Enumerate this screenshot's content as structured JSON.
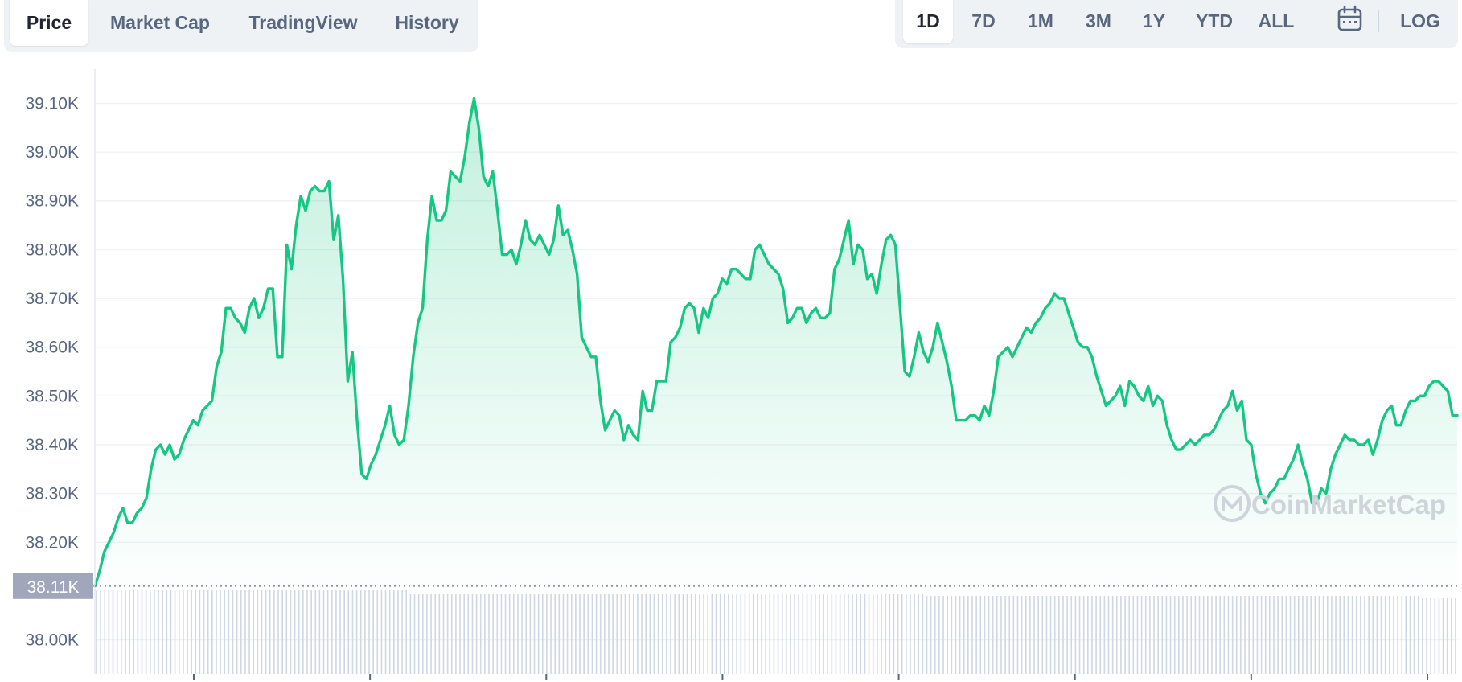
{
  "tabs": [
    {
      "label": "Price",
      "active": true
    },
    {
      "label": "Market Cap",
      "active": false
    },
    {
      "label": "TradingView",
      "active": false
    },
    {
      "label": "History",
      "active": false
    }
  ],
  "ranges": [
    {
      "label": "1D",
      "active": true
    },
    {
      "label": "7D",
      "active": false
    },
    {
      "label": "1M",
      "active": false
    },
    {
      "label": "3M",
      "active": false
    },
    {
      "label": "1Y",
      "active": false
    },
    {
      "label": "YTD",
      "active": false
    },
    {
      "label": "ALL",
      "active": false
    }
  ],
  "calendar_icon": "calendar-icon",
  "log_label": "LOG",
  "watermark": "CoinMarketCap",
  "colors": {
    "line": "#16c784",
    "fill_top": "#16c784",
    "grid": "#eff2f5",
    "text": "#58667e",
    "badge": "#a1a7bb",
    "volume": "#cfd6e4",
    "tab_bg": "#eff2f5"
  },
  "chart_data": {
    "type": "area",
    "title": "",
    "xlabel": "",
    "ylabel": "",
    "ylim": [
      37.93,
      39.17
    ],
    "y_ticks": [
      38.0,
      38.2,
      38.3,
      38.4,
      38.5,
      38.6,
      38.7,
      38.8,
      38.9,
      39.0,
      39.1
    ],
    "y_tick_labels": [
      "38.00K",
      "38.20K",
      "38.30K",
      "38.40K",
      "38.50K",
      "38.60K",
      "38.70K",
      "38.80K",
      "38.90K",
      "39.00K",
      "39.10K"
    ],
    "baseline": {
      "value": 38.11,
      "label": "38.11K"
    },
    "x_tick_count": 8,
    "grid": true,
    "legend": "none",
    "series": [
      {
        "values": [
          38.11,
          38.14,
          38.18,
          38.2,
          38.22,
          38.25,
          38.27,
          38.24,
          38.24,
          38.26,
          38.27,
          38.29,
          38.35,
          38.39,
          38.4,
          38.38,
          38.4,
          38.37,
          38.38,
          38.41,
          38.43,
          38.45,
          38.44,
          38.47,
          38.48,
          38.49,
          38.56,
          38.59,
          38.68,
          38.68,
          38.66,
          38.65,
          38.63,
          38.68,
          38.7,
          38.66,
          38.68,
          38.72,
          38.72,
          38.58,
          38.58,
          38.81,
          38.76,
          38.85,
          38.91,
          38.88,
          38.92,
          38.93,
          38.92,
          38.92,
          38.94,
          38.82,
          38.87,
          38.74,
          38.53,
          38.59,
          38.45,
          38.34,
          38.33,
          38.36,
          38.38,
          38.41,
          38.44,
          38.48,
          38.42,
          38.4,
          38.41,
          38.48,
          38.58,
          38.65,
          38.68,
          38.82,
          38.91,
          38.86,
          38.86,
          38.88,
          38.96,
          38.95,
          38.94,
          38.99,
          39.06,
          39.11,
          39.05,
          38.95,
          38.93,
          38.96,
          38.88,
          38.79,
          38.79,
          38.8,
          38.77,
          38.81,
          38.86,
          38.82,
          38.81,
          38.83,
          38.81,
          38.79,
          38.82,
          38.89,
          38.83,
          38.84,
          38.8,
          38.75,
          38.62,
          38.6,
          38.58,
          38.58,
          38.49,
          38.43,
          38.45,
          38.47,
          38.46,
          38.41,
          38.44,
          38.42,
          38.41,
          38.51,
          38.47,
          38.47,
          38.53,
          38.53,
          38.53,
          38.61,
          38.62,
          38.64,
          38.68,
          38.69,
          38.68,
          38.63,
          38.68,
          38.66,
          38.7,
          38.71,
          38.74,
          38.73,
          38.76,
          38.76,
          38.75,
          38.74,
          38.74,
          38.8,
          38.81,
          38.79,
          38.77,
          38.76,
          38.75,
          38.72,
          38.65,
          38.66,
          38.68,
          38.68,
          38.65,
          38.67,
          38.68,
          38.66,
          38.66,
          38.67,
          38.76,
          38.78,
          38.82,
          38.86,
          38.77,
          38.81,
          38.8,
          38.74,
          38.75,
          38.71,
          38.77,
          38.82,
          38.83,
          38.81,
          38.68,
          38.55,
          38.54,
          38.58,
          38.63,
          38.59,
          38.57,
          38.6,
          38.65,
          38.61,
          38.57,
          38.52,
          38.45,
          38.45,
          38.45,
          38.46,
          38.46,
          38.45,
          38.48,
          38.46,
          38.51,
          38.58,
          38.59,
          38.6,
          38.58,
          38.6,
          38.62,
          38.64,
          38.63,
          38.65,
          38.66,
          38.68,
          38.69,
          38.71,
          38.7,
          38.7,
          38.67,
          38.64,
          38.61,
          38.6,
          38.6,
          38.58,
          38.54,
          38.51,
          38.48,
          38.49,
          38.5,
          38.52,
          38.48,
          38.53,
          38.52,
          38.5,
          38.49,
          38.52,
          38.48,
          38.5,
          38.49,
          38.44,
          38.41,
          38.39,
          38.39,
          38.4,
          38.41,
          38.4,
          38.41,
          38.42,
          38.42,
          38.43,
          38.45,
          38.47,
          38.48,
          38.51,
          38.47,
          38.49,
          38.41,
          38.4,
          38.34,
          38.3,
          38.28,
          38.3,
          38.31,
          38.33,
          38.33,
          38.35,
          38.37,
          38.4,
          38.36,
          38.33,
          38.28,
          38.28,
          38.31,
          38.3,
          38.35,
          38.38,
          38.4,
          38.42,
          38.41,
          38.41,
          38.4,
          38.4,
          38.41,
          38.38,
          38.41,
          38.45,
          38.47,
          38.48,
          38.44,
          38.44,
          38.47,
          38.49,
          38.49,
          38.5,
          38.5,
          38.52,
          38.53,
          38.53,
          38.52,
          38.51,
          38.46,
          38.46
        ]
      }
    ]
  }
}
